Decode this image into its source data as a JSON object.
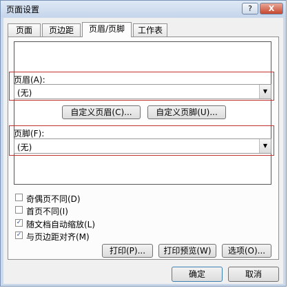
{
  "window": {
    "title": "页面设置",
    "help_label": "?",
    "close_label": "X"
  },
  "tabs": [
    {
      "label": "页面"
    },
    {
      "label": "页边距"
    },
    {
      "label": "页眉/页脚"
    },
    {
      "label": "工作表"
    }
  ],
  "header": {
    "label": "页眉(A):",
    "value": "(无)",
    "custom_button": "自定义页眉(C)..."
  },
  "footer": {
    "label": "页脚(F):",
    "value": "(无)",
    "custom_button": "自定义页脚(U)..."
  },
  "options": [
    {
      "label": "奇偶页不同(D)",
      "checked": false
    },
    {
      "label": "首页不同(I)",
      "checked": false
    },
    {
      "label": "随文档自动缩放(L)",
      "checked": true
    },
    {
      "label": "与页边距对齐(M)",
      "checked": true
    }
  ],
  "check_mark": "✓",
  "arrow_glyph": "▼",
  "buttons": {
    "print": "打印(P)...",
    "print_preview": "打印预览(W)",
    "options": "选项(O)..."
  },
  "footer_buttons": {
    "ok": "确定",
    "cancel": "取消"
  }
}
